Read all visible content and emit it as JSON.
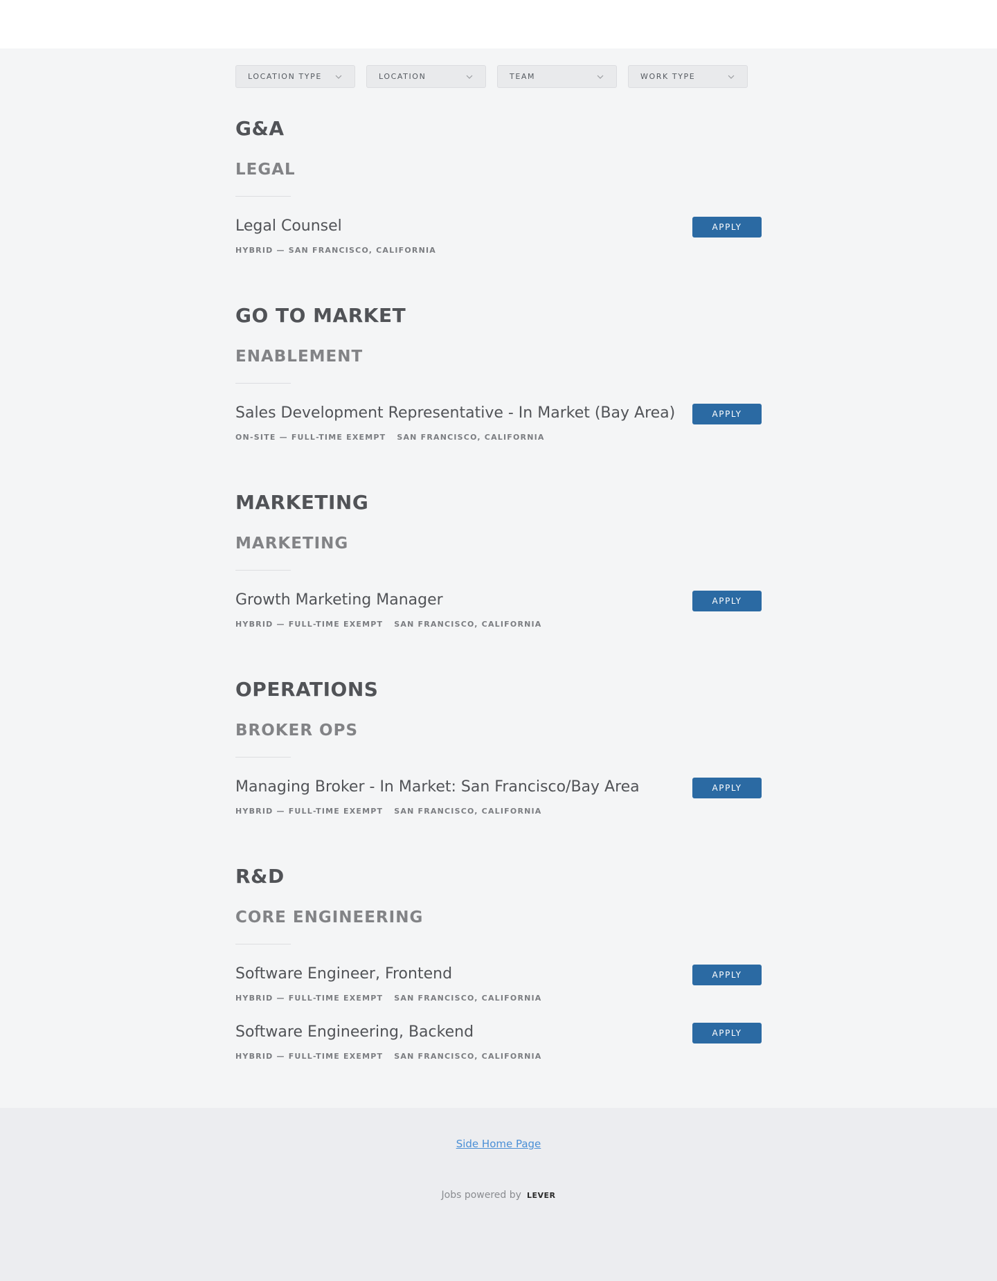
{
  "filters": [
    {
      "label": "LOCATION TYPE",
      "icon": "chevron-down-icon"
    },
    {
      "label": "LOCATION",
      "icon": "chevron-down-icon"
    },
    {
      "label": "TEAM",
      "icon": "chevron-down-icon"
    },
    {
      "label": "WORK TYPE",
      "icon": "chevron-down-icon"
    }
  ],
  "groups": [
    {
      "department": "G&A",
      "team": "LEGAL",
      "postings": [
        {
          "title": "Legal Counsel",
          "meta1": "HYBRID — SAN FRANCISCO, CALIFORNIA",
          "meta2": "",
          "apply": "APPLY"
        }
      ]
    },
    {
      "department": "GO TO MARKET",
      "team": "ENABLEMENT",
      "postings": [
        {
          "title": "Sales Development Representative - In Market (Bay Area)",
          "meta1": "ON-SITE — FULL-TIME EXEMPT",
          "meta2": "SAN FRANCISCO, CALIFORNIA",
          "apply": "APPLY"
        }
      ]
    },
    {
      "department": "MARKETING",
      "team": "MARKETING",
      "postings": [
        {
          "title": "Growth Marketing Manager",
          "meta1": "HYBRID — FULL-TIME EXEMPT",
          "meta2": "SAN FRANCISCO, CALIFORNIA",
          "apply": "APPLY"
        }
      ]
    },
    {
      "department": "OPERATIONS",
      "team": "BROKER OPS",
      "postings": [
        {
          "title": "Managing Broker - In Market: San Francisco/Bay Area",
          "meta1": "HYBRID — FULL-TIME EXEMPT",
          "meta2": "SAN FRANCISCO, CALIFORNIA",
          "apply": "APPLY"
        }
      ]
    },
    {
      "department": "R&D",
      "team": "CORE ENGINEERING",
      "postings": [
        {
          "title": "Software Engineer, Frontend",
          "meta1": "HYBRID — FULL-TIME EXEMPT",
          "meta2": "SAN FRANCISCO, CALIFORNIA",
          "apply": "APPLY"
        },
        {
          "title": "Software Engineering, Backend",
          "meta1": "HYBRID — FULL-TIME EXEMPT",
          "meta2": "SAN FRANCISCO, CALIFORNIA",
          "apply": "APPLY"
        }
      ]
    }
  ],
  "footer": {
    "home_link": "Side Home Page",
    "powered_by": "Jobs powered by",
    "brand": "LEVER"
  },
  "colors": {
    "apply_button": "#2b6aa3",
    "link": "#4a8fd6"
  }
}
